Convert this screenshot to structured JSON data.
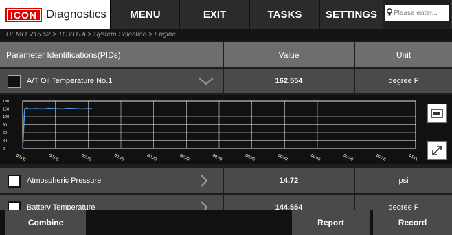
{
  "header": {
    "logo_text": "ICON",
    "app_title": "Diagnostics",
    "menu_label": "MENU",
    "exit_label": "EXIT",
    "tasks_label": "TASKS",
    "settings_label": "SETTINGS",
    "search_placeholder": "Please enter..."
  },
  "breadcrumb": "DEMO V15.52 > TOYOTA > System Selection > Engine",
  "table": {
    "columns": [
      "Parameter Identifications(PIDs)",
      "Value",
      "Unit"
    ],
    "rows": [
      {
        "name": "A/T Oil Temperature No.1",
        "value": "162.554",
        "unit": "degree F",
        "checked": false,
        "expanded": true
      },
      {
        "name": "Atmospheric Pressure",
        "value": "14.72",
        "unit": "psi",
        "checked": false,
        "expanded": false
      },
      {
        "name": "Battery Temperature",
        "value": "144.554",
        "unit": "degree F",
        "checked": false,
        "expanded": false
      }
    ]
  },
  "chart_data": {
    "type": "line",
    "title": "",
    "xlabel": "",
    "ylabel": "",
    "ylim": [
      0,
      180
    ],
    "xlim": [
      0,
      60
    ],
    "y_ticks": [
      "0",
      "30",
      "60",
      "90",
      "120",
      "150",
      "180"
    ],
    "x_ticks": [
      "00:00",
      "00:05",
      "00:10",
      "00:15",
      "00:20",
      "00:25",
      "00:30",
      "00:35",
      "00:40",
      "00:45",
      "00:50",
      "00:55",
      "01:00"
    ],
    "grid": true,
    "series": [
      {
        "x": [
          0,
          0.3,
          0.6,
          1,
          2,
          3,
          4,
          5,
          6,
          7,
          8,
          9,
          10,
          10.6
        ],
        "y": [
          0,
          150,
          153,
          150,
          151,
          150,
          152,
          151,
          150,
          152,
          151,
          150,
          151,
          151
        ],
        "color": "#4a9af0"
      }
    ]
  },
  "bottom": {
    "combine_label": "Combine",
    "report_label": "Report",
    "record_label": "Record"
  },
  "colors": {
    "brand_red": "#e00000",
    "header_gray": "#6e6e6e",
    "row_gray": "#4a4a4a",
    "line_blue": "#4a9af0"
  }
}
